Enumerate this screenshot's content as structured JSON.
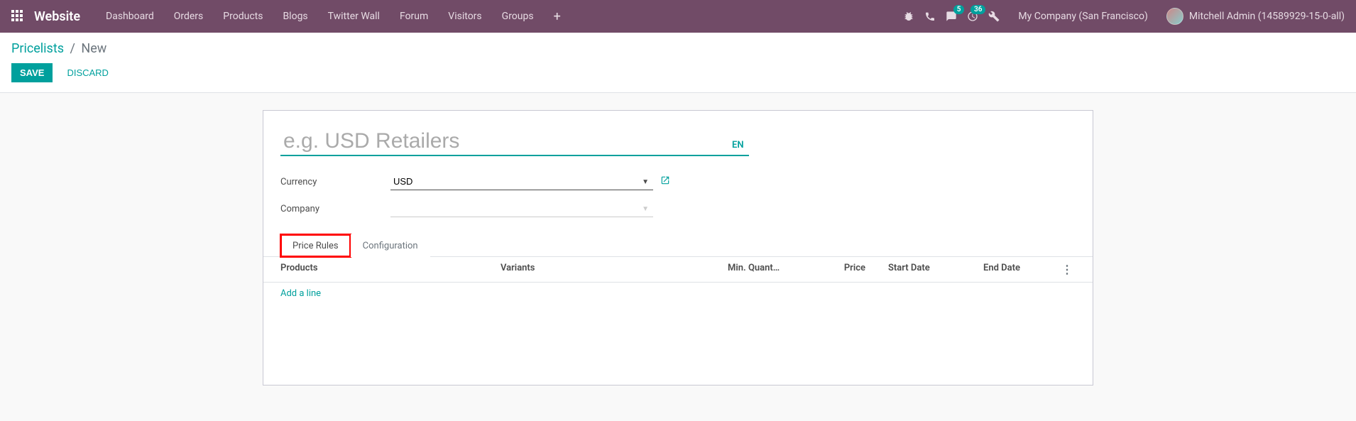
{
  "navbar": {
    "brand": "Website",
    "menu": [
      "Dashboard",
      "Orders",
      "Products",
      "Blogs",
      "Twitter Wall",
      "Forum",
      "Visitors",
      "Groups"
    ],
    "plus": "+",
    "messages_badge": "5",
    "activities_badge": "36",
    "company": "My Company (San Francisco)",
    "user": "Mitchell Admin (14589929-15-0-all)"
  },
  "breadcrumb": {
    "parent": "Pricelists",
    "sep": "/",
    "current": "New"
  },
  "buttons": {
    "save": "Save",
    "discard": "Discard"
  },
  "form": {
    "name_placeholder": "e.g. USD Retailers",
    "name_value": "",
    "lang": "EN",
    "currency_label": "Currency",
    "currency_value": "USD",
    "company_label": "Company",
    "company_value": ""
  },
  "tabs": {
    "rules": "Price Rules",
    "config": "Configuration"
  },
  "table": {
    "headers": {
      "products": "Products",
      "variants": "Variants",
      "minq": "Min. Quant…",
      "price": "Price",
      "start": "Start Date",
      "end": "End Date"
    },
    "add_line": "Add a line",
    "kebab": "⋮"
  }
}
